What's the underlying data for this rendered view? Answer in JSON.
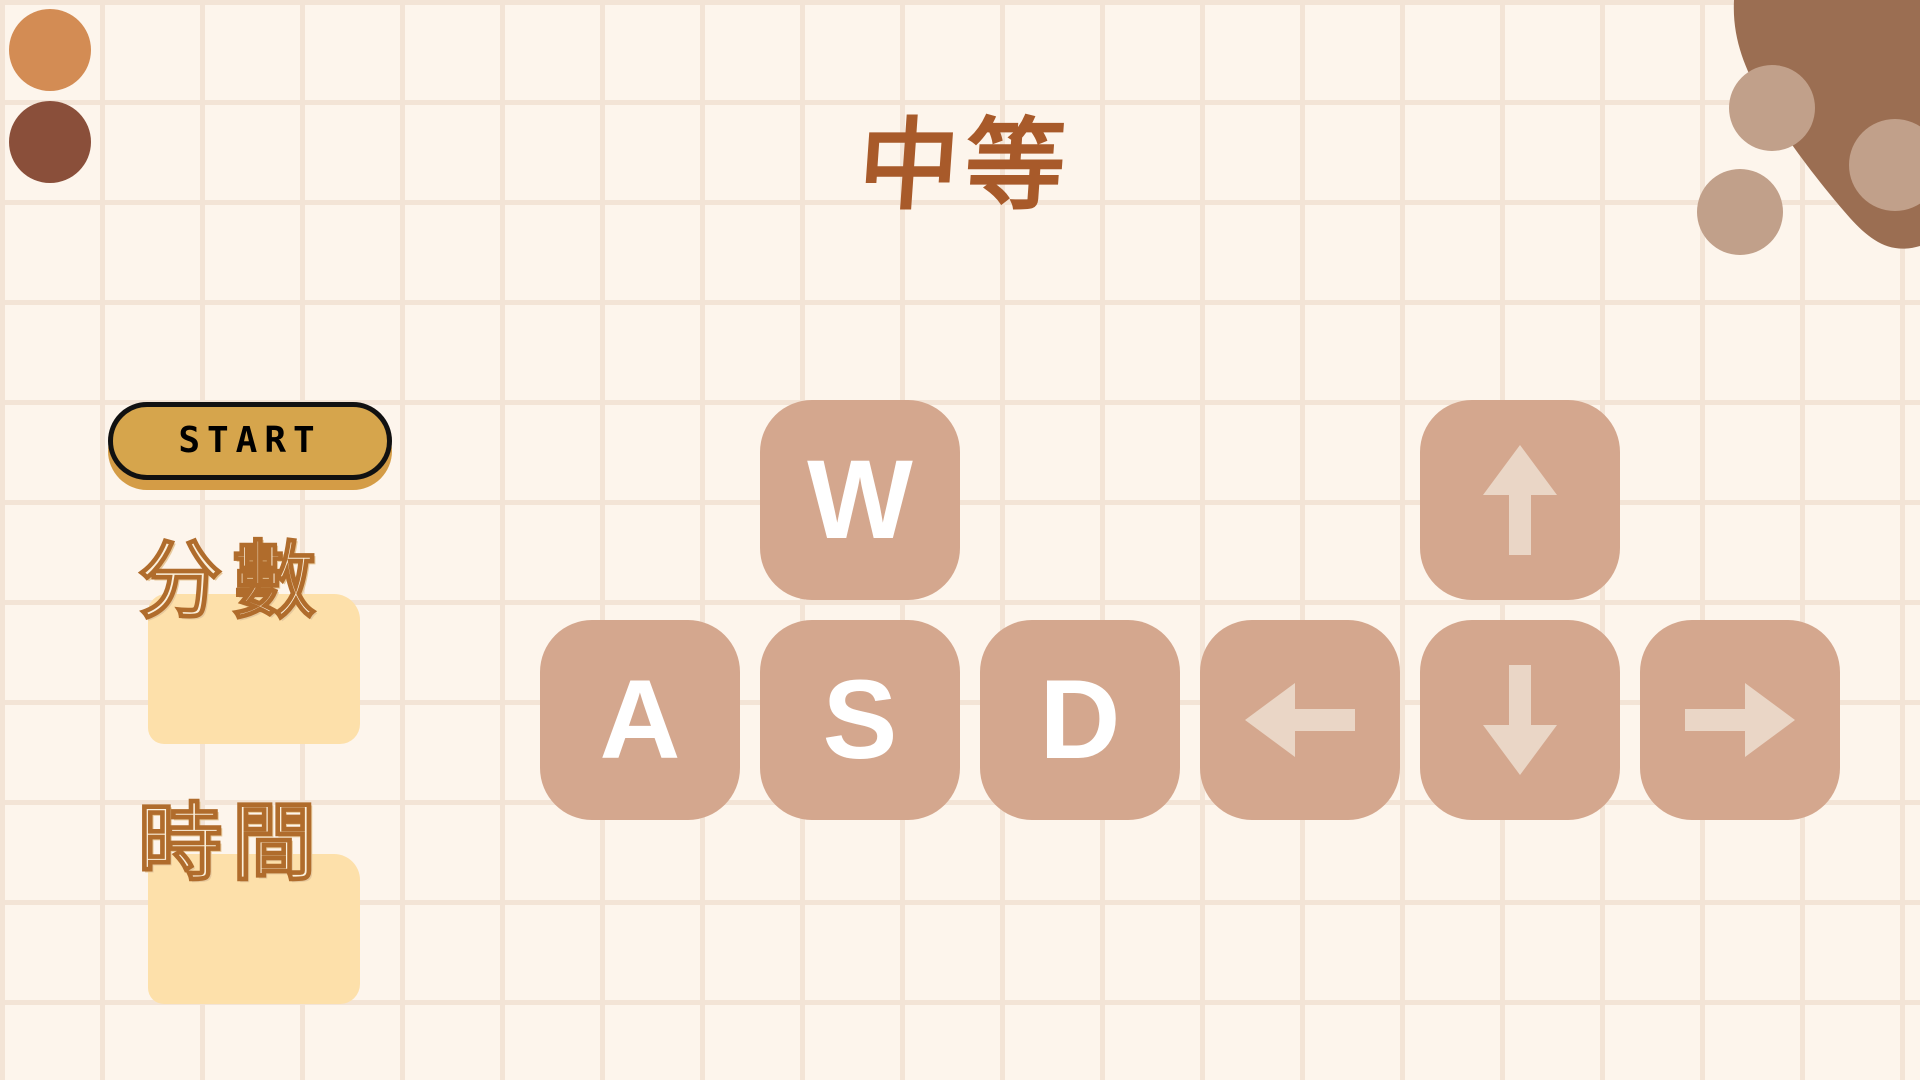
{
  "header": {
    "title": "中等"
  },
  "controls": {
    "start_label": "START"
  },
  "stats": {
    "score_label": "分數",
    "time_label": "時間"
  },
  "keys": {
    "letters": [
      "W",
      "A",
      "S",
      "D"
    ],
    "arrows": [
      {
        "direction": "up",
        "icon": "arrow-up-icon"
      },
      {
        "direction": "left",
        "icon": "arrow-left-icon"
      },
      {
        "direction": "down",
        "icon": "arrow-down-icon"
      },
      {
        "direction": "right",
        "icon": "arrow-right-icon"
      }
    ]
  },
  "colors": {
    "background": "#fdf5ec",
    "grid": "#f3e4d6",
    "title": "#a85a2a",
    "start_button": "#d6a54c",
    "start_shadow": "#d49c46",
    "key_bg": "#d4a78e",
    "key_letter": "#ffffff",
    "arrow": "#ead6c6",
    "pad": "#fde0aa",
    "dot_orange": "#d38c54",
    "dot_brown": "#8a4f3a",
    "corner_blob": "#9b6e52",
    "corner_pebble": "#c1a08a"
  }
}
